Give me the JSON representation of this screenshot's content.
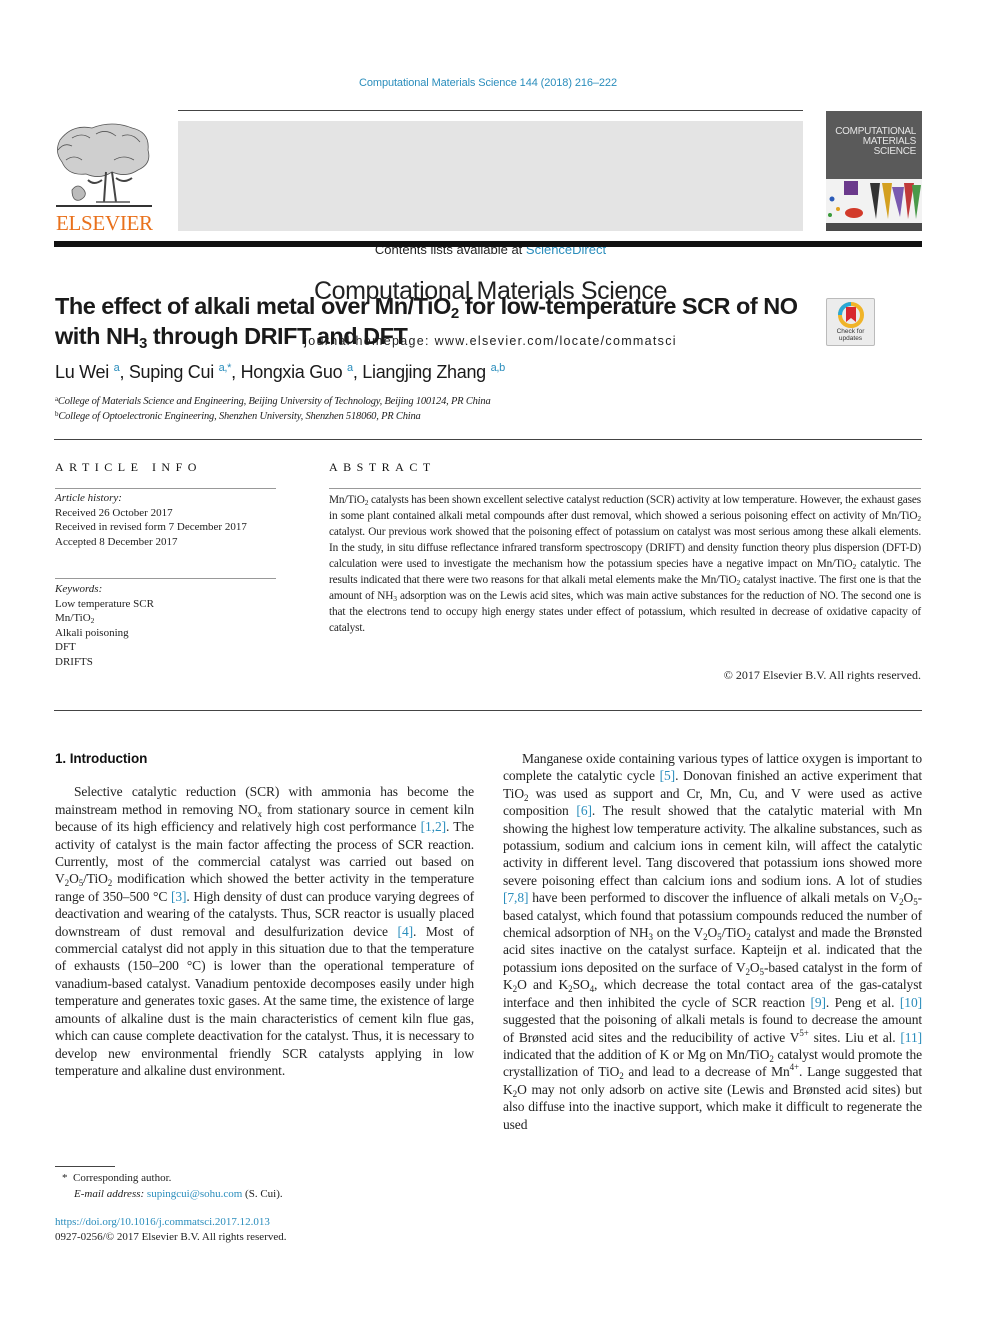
{
  "running_head": "Computational Materials Science 144 (2018) 216–222",
  "masthead": {
    "publisher_logo_text": "ELSEVIER",
    "contents_prefix": "Contents lists available at ",
    "contents_link": "ScienceDirect",
    "journal_title": "Computational Materials Science",
    "homepage": "journal homepage: www.elsevier.com/locate/commatsci",
    "cover_title_lines": [
      "COMPUTATIONAL",
      "MATERIALS",
      "SCIENCE"
    ]
  },
  "check_updates": {
    "line1": "Check for",
    "line2": "updates"
  },
  "article": {
    "title_parts": {
      "p1": "The effect of alkali metal over Mn/TiO",
      "s1": "2",
      "p2": " for low-temperature SCR of NO",
      "p3": "with NH",
      "s2": "3",
      "p4": " through DRIFT and DFT"
    },
    "authors": [
      {
        "name": "Lu Wei",
        "sup": "a"
      },
      {
        "name": "Suping Cui",
        "sup": "a,*"
      },
      {
        "name": "Hongxia Guo",
        "sup": "a"
      },
      {
        "name": "Liangjing Zhang",
        "sup": "a,b"
      }
    ],
    "affiliations": [
      {
        "mark": "a",
        "text": "College of Materials Science and Engineering, Beijing University of Technology, Beijing 100124, PR China"
      },
      {
        "mark": "b",
        "text": "College of Optoelectronic Engineering, Shenzhen University, Shenzhen 518060, PR China"
      }
    ]
  },
  "article_info": {
    "heading": "ARTICLE INFO",
    "history_label": "Article history:",
    "history": [
      "Received 26 October 2017",
      "Received in revised form 7 December 2017",
      "Accepted 8 December 2017"
    ],
    "keywords_label": "Keywords:",
    "keywords": [
      "Low temperature SCR",
      "Mn/TiO",
      "Alkali poisoning",
      "DFT",
      "DRIFTS"
    ],
    "keyword_sub": "2"
  },
  "abstract": {
    "heading": "ABSTRACT",
    "segments": {
      "a1": "Mn/TiO",
      "a2": " catalysts has been shown excellent selective catalyst reduction (SCR) activity at low temperature. However, the exhaust gases in some plant contained alkali metal compounds after dust removal, which showed a serious poisoning effect on activity of Mn/TiO",
      "a3": " catalyst. Our previous work showed that the poisoning effect of potassium on catalyst was most serious among these alkali elements. In the study, in situ diffuse reflectance infrared transform spectroscopy (DRIFT) and density function theory plus dispersion (DFT-D) calculation were used to investigate the mechanism how the potassium species have a negative impact on Mn/TiO",
      "a4": " catalytic. The results indicated that there were two reasons for that alkali metal elements make the Mn/TiO",
      "a5": " catalyst inactive. The first one is that the amount of NH",
      "a6": " adsorption was on the Lewis acid sites, which was main active substances for the reduction of NO. The second one is that the electrons tend to occupy high energy states under effect of potassium, which resulted in decrease of oxidative capacity of catalyst.",
      "sub2": "2",
      "sub3": "3"
    },
    "copyright": "© 2017 Elsevier B.V. All rights reserved."
  },
  "intro": {
    "heading": "1. Introduction",
    "left": {
      "t1": "Selective catalytic reduction (SCR) with ammonia has become the mainstream method in removing NO",
      "x": "x",
      "t2": " from stationary source in cement kiln because of its high efficiency and relatively high cost performance ",
      "c1": "[1,2]",
      "t3": ". The activity of catalyst is the main factor affecting the process of SCR reaction. Currently, most of the commercial catalyst was carried out based on V",
      "t4": "O",
      "t5": "/TiO",
      "t6": " modification which showed the better activity in the temperature range of 350–500 °C ",
      "c2": "[3]",
      "t7": ". High density of dust can produce varying degrees of deactivation and wearing of the catalysts. Thus, SCR reactor is usually placed downstream of dust removal and desulfurization device ",
      "c3": "[4]",
      "t8": ". Most of commercial catalyst did not apply in this situation due to that the temperature of exhausts (150–200 °C) is lower than the operational temperature of vanadium-based catalyst. Vanadium pentoxide decomposes easily under high temperature and generates toxic gases. At the same time, the existence of large amounts of alkaline dust is the main characteristics of cement kiln flue gas, which can cause complete deactivation for the catalyst. Thus, it is necessary to develop new environmental friendly SCR catalysts applying in low temperature and alkaline dust environment.",
      "s2": "2",
      "s5": "5"
    },
    "right": {
      "r1": "Manganese oxide containing various types of lattice oxygen is important to complete the catalytic cycle ",
      "c5": "[5]",
      "r2": ". Donovan finished an active experiment that TiO",
      "r3": " was used as support and Cr, Mn, Cu, and V were used as active composition ",
      "c6": "[6]",
      "r4": ". The result showed that the catalytic material with Mn showing the highest low temperature activity. The alkaline substances, such as potassium, sodium and calcium ions in cement kiln, will affect the catalytic activity in different level. Tang discovered that potassium ions showed more severe poisoning effect than calcium ions and sodium ions. A lot of studies ",
      "c78": "[7,8]",
      "r5": " have been performed to discover the influence of alkali metals on V",
      "r6": "O",
      "r7": "-based catalyst, which found that potassium compounds reduced the number of chemical adsorption of NH",
      "r8": " on the V",
      "r9": "/TiO",
      "r10": " catalyst and made the Brønsted acid sites inactive on the catalyst surface. Kapteijn et al. indicated that the potassium ions deposited on the surface of V",
      "r11": "-based catalyst in the form of K",
      "r12": "O and K",
      "r13": "SO",
      "r14": ", which decrease the total contact area of the gas-catalyst interface and then inhibited the cycle of SCR reaction ",
      "c9": "[9]",
      "r15": ". Peng et al. ",
      "c10": "[10]",
      "r16": " suggested that the poisoning of alkali metals is found to decrease the amount of Brønsted acid sites and the reducibility of active V",
      "sup5": "5+",
      "r17": " sites. Liu et al. ",
      "c11": "[11]",
      "r18": " indicated that the addition of K or Mg on Mn/TiO",
      "r19": " catalyst would promote the crystallization of TiO",
      "r20": " and lead to a decrease of Mn",
      "sup4": "4+",
      "r21": ". Lange suggested that K",
      "r22": "O may not only adsorb on active site (Lewis and Brønsted acid sites) but also diffuse into the inactive support, which make it difficult to regenerate the used",
      "s2": "2",
      "s3": "3",
      "s4": "4",
      "s5": "5"
    }
  },
  "footnotes": {
    "star": "*",
    "corresponding": "Corresponding author.",
    "email_label": "E-mail address:",
    "email": "supingcui@sohu.com",
    "email_suffix": " (S. Cui)."
  },
  "doi": {
    "link": "https://doi.org/10.1016/j.commatsci.2017.12.013",
    "issn_line": "0927-0256/© 2017 Elsevier B.V. All rights reserved."
  },
  "colors": {
    "link": "#2a8dbc",
    "elsevier_orange": "#e9711c",
    "masthead_bg": "#e4e4e4"
  }
}
